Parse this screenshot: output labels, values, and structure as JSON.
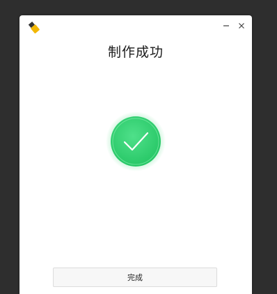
{
  "dialog": {
    "title": "制作成功",
    "done_label": "完成"
  },
  "icons": {
    "logo": "usb-drive-icon",
    "success": "success-check-icon",
    "minimize": "minimize-icon",
    "close": "close-icon"
  },
  "colors": {
    "success_green": "#36d472",
    "background": "#2e2e2e",
    "window": "#ffffff"
  }
}
